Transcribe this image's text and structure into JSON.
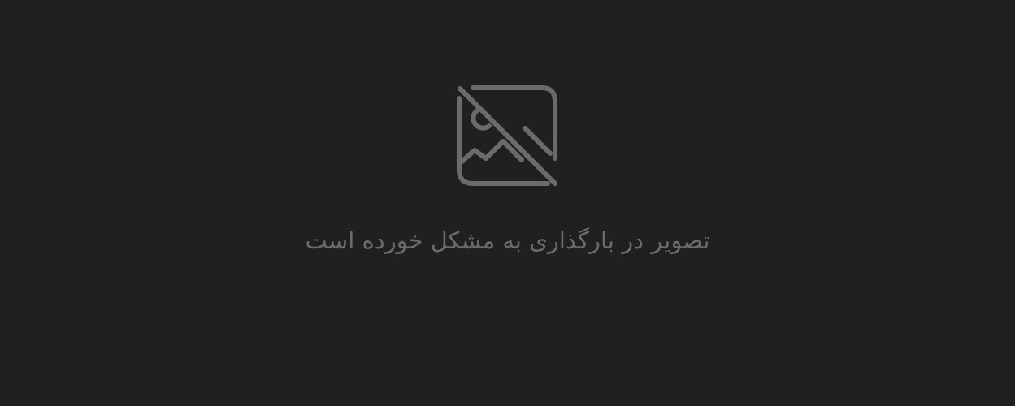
{
  "placeholder": {
    "icon": "broken-image-icon",
    "message": "تصویر در بارگذاری به مشکل خورده است",
    "colors": {
      "background": "#202020",
      "foreground": "#6b6b6b"
    }
  }
}
